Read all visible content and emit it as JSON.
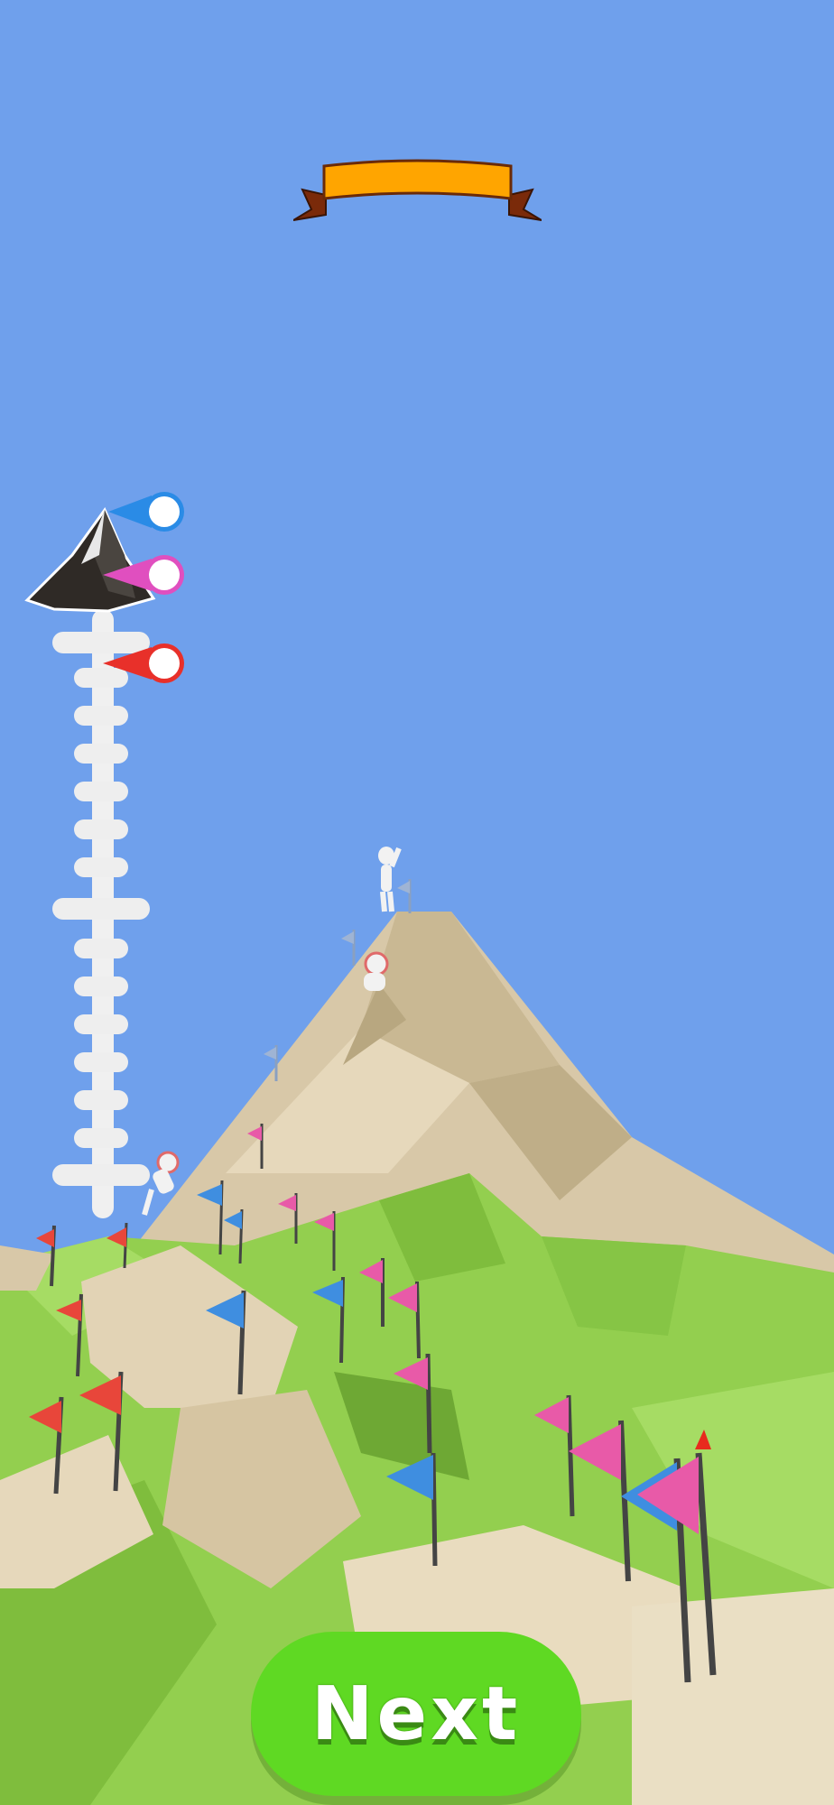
{
  "screen": {
    "sky_color": "#6fa0ec",
    "ground_green": "#93cf4f",
    "rock_color": "#d8c8a8"
  },
  "banner": {
    "ribbon_color": "#ffa500",
    "tail_color": "#7a2a0a"
  },
  "progress": {
    "summit_icon": "mountain-summit-icon",
    "markers": [
      {
        "color": "#2a8be6",
        "label": "blue-rival"
      },
      {
        "color": "#e04fbf",
        "label": "pink-rival"
      },
      {
        "color": "#e8302a",
        "label": "red-player"
      }
    ]
  },
  "next_button": {
    "label": "Next",
    "color": "#5fd923"
  }
}
